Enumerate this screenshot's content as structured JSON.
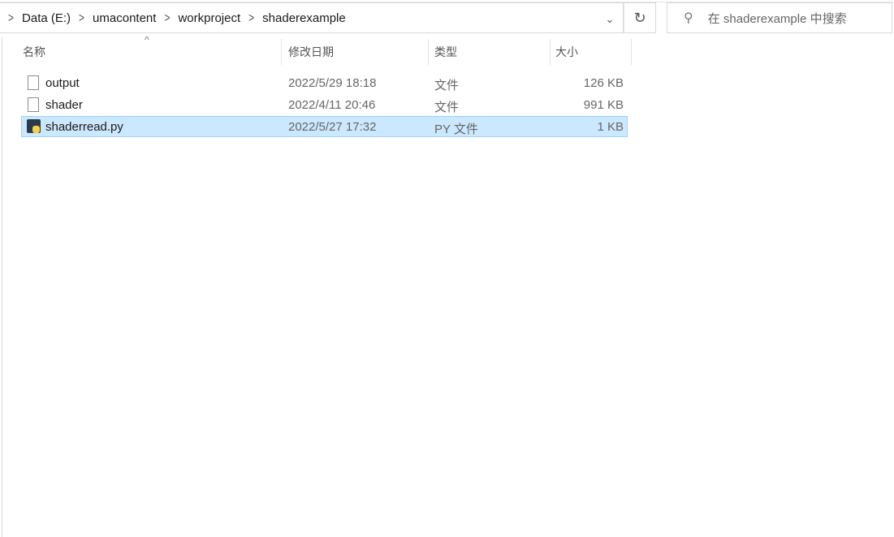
{
  "address": {
    "crumbs": [
      "Data (E:)",
      "umacontent",
      "workproject",
      "shaderexample"
    ]
  },
  "search": {
    "placeholder": "在 shaderexample 中搜索"
  },
  "columns": {
    "name": "名称",
    "date": "修改日期",
    "type": "类型",
    "size": "大小"
  },
  "files": [
    {
      "name": "output",
      "date": "2022/5/29 18:18",
      "type": "文件",
      "size": "126 KB",
      "icon": "file-icon",
      "selected": false
    },
    {
      "name": "shader",
      "date": "2022/4/11 20:46",
      "type": "文件",
      "size": "991 KB",
      "icon": "file-icon",
      "selected": false
    },
    {
      "name": "shaderread.py",
      "date": "2022/5/27 17:32",
      "type": "PY 文件",
      "size": "1 KB",
      "icon": "python-file-icon",
      "selected": true
    }
  ],
  "colors": {
    "selection": "#cce8ff",
    "selection_border": "#99d1ff"
  }
}
